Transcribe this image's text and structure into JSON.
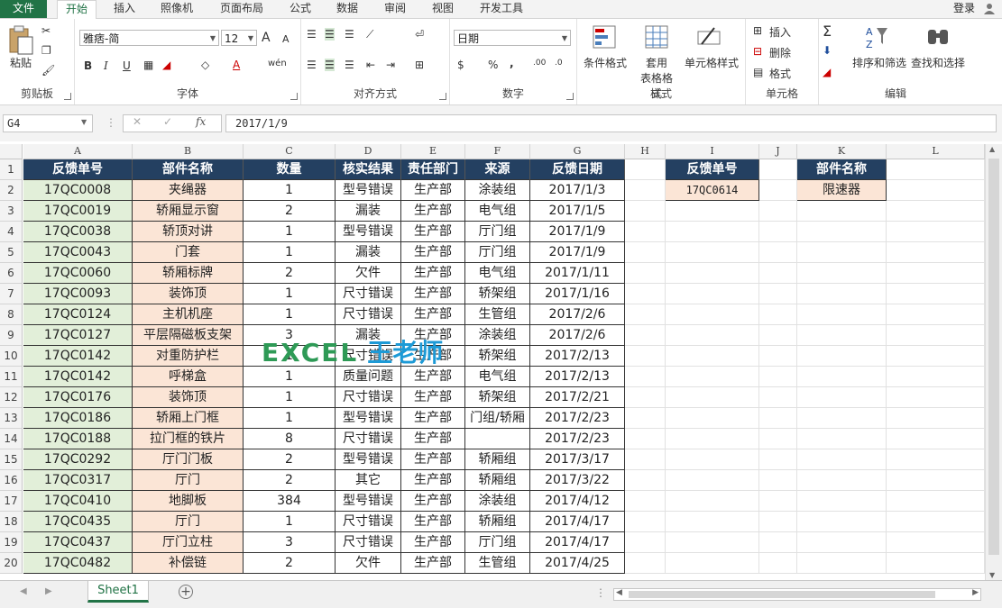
{
  "tabs": [
    "文件",
    "开始",
    "插入",
    "照像机",
    "页面布局",
    "公式",
    "数据",
    "审阅",
    "视图",
    "开发工具"
  ],
  "login_label": "登录",
  "ribbon": {
    "clipboard": {
      "label": "剪贴板",
      "paste": "粘贴"
    },
    "font": {
      "label": "字体",
      "name": "雅痞-简",
      "size": "12",
      "bold": "B",
      "italic": "I",
      "underline": "U",
      "grow": "A",
      "shrink": "A",
      "wen": "wén"
    },
    "alignment": {
      "label": "对齐方式"
    },
    "number": {
      "label": "数字",
      "format": "日期",
      "percent": "%",
      "comma": ","
    },
    "styles": {
      "label": "样式",
      "cond_format": "条件格式",
      "table_format_1": "套用",
      "table_format_2": "表格格式",
      "cell_styles": "单元格样式"
    },
    "cells": {
      "label": "单元格",
      "insert": "插入",
      "delete": "删除",
      "format": "格式"
    },
    "editing": {
      "label": "编辑",
      "sort": "排序和筛选",
      "find": "查找和选择"
    }
  },
  "formula_bar": {
    "name_box": "G4",
    "fx": "fx",
    "value": "2017/1/9"
  },
  "columns": [
    "A",
    "B",
    "C",
    "D",
    "E",
    "F",
    "G",
    "H",
    "I",
    "J",
    "K",
    "L"
  ],
  "rows": [
    "1",
    "2",
    "3",
    "4",
    "5",
    "6",
    "7",
    "8",
    "9",
    "10",
    "11",
    "12",
    "13",
    "14",
    "15",
    "16",
    "17",
    "18",
    "19",
    "20"
  ],
  "table": {
    "headers": [
      "反馈单号",
      "部件名称",
      "数量",
      "核实结果",
      "责任部门",
      "来源",
      "反馈日期"
    ],
    "rows": [
      [
        "17QC0008",
        "夹绳器",
        "1",
        "型号错误",
        "生产部",
        "涂装组",
        "2017/1/3"
      ],
      [
        "17QC0019",
        "轿厢显示窗",
        "2",
        "漏装",
        "生产部",
        "电气组",
        "2017/1/5"
      ],
      [
        "17QC0038",
        "轿顶对讲",
        "1",
        "型号错误",
        "生产部",
        "厅门组",
        "2017/1/9"
      ],
      [
        "17QC0043",
        "门套",
        "1",
        "漏装",
        "生产部",
        "厅门组",
        "2017/1/9"
      ],
      [
        "17QC0060",
        "轿厢标牌",
        "2",
        "欠件",
        "生产部",
        "电气组",
        "2017/1/11"
      ],
      [
        "17QC0093",
        "装饰顶",
        "1",
        "尺寸错误",
        "生产部",
        "轿架组",
        "2017/1/16"
      ],
      [
        "17QC0124",
        "主机机座",
        "1",
        "尺寸错误",
        "生产部",
        "生管组",
        "2017/2/6"
      ],
      [
        "17QC0127",
        "平层隔磁板支架",
        "3",
        "漏装",
        "生产部",
        "涂装组",
        "2017/2/6"
      ],
      [
        "17QC0142",
        "对重防护栏",
        "1",
        "尺寸错误",
        "生产部",
        "轿架组",
        "2017/2/13"
      ],
      [
        "17QC0142",
        "呼梯盒",
        "1",
        "质量问题",
        "生产部",
        "电气组",
        "2017/2/13"
      ],
      [
        "17QC0176",
        "装饰顶",
        "1",
        "尺寸错误",
        "生产部",
        "轿架组",
        "2017/2/21"
      ],
      [
        "17QC0186",
        "轿厢上门框",
        "1",
        "型号错误",
        "生产部",
        "门组/轿厢",
        "2017/2/23"
      ],
      [
        "17QC0188",
        "拉门框的铁片",
        "8",
        "尺寸错误",
        "生产部",
        "",
        "2017/2/23"
      ],
      [
        "17QC0292",
        "厅门门板",
        "2",
        "型号错误",
        "生产部",
        "轿厢组",
        "2017/3/17"
      ],
      [
        "17QC0317",
        "厅门",
        "2",
        "其它",
        "生产部",
        "轿厢组",
        "2017/3/22"
      ],
      [
        "17QC0410",
        "地脚板",
        "384",
        "型号错误",
        "生产部",
        "涂装组",
        "2017/4/12"
      ],
      [
        "17QC0435",
        "厅门",
        "1",
        "尺寸错误",
        "生产部",
        "轿厢组",
        "2017/4/17"
      ],
      [
        "17QC0437",
        "厅门立柱",
        "3",
        "尺寸错误",
        "生产部",
        "厅门组",
        "2017/4/17"
      ],
      [
        "17QC0482",
        "补偿链",
        "2",
        "欠件",
        "生产部",
        "生管组",
        "2017/4/25"
      ]
    ]
  },
  "lookup": {
    "i_header": "反馈单号",
    "i_value": "17QC0614",
    "k_header": "部件名称",
    "k_value": "限速器"
  },
  "watermark": {
    "part1": "EXCEL",
    "part2": "王老师"
  },
  "sheet_tab": "Sheet1"
}
